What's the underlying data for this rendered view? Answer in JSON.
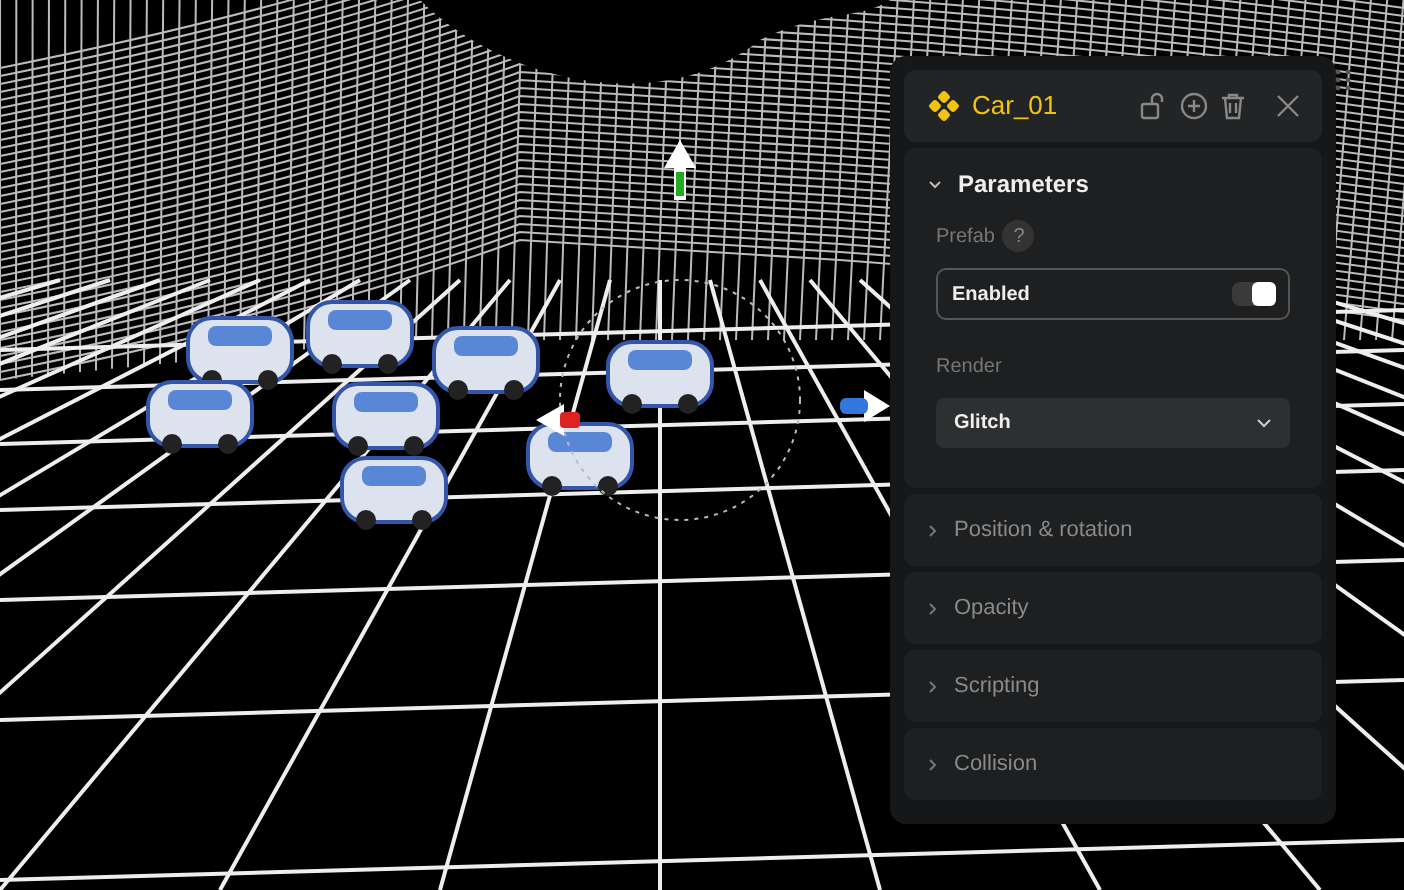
{
  "object": {
    "name": "Car_01"
  },
  "sections": [
    {
      "title": "Parameters",
      "expanded": true
    },
    {
      "title": "Position & rotation",
      "expanded": false
    },
    {
      "title": "Opacity",
      "expanded": false
    },
    {
      "title": "Scripting",
      "expanded": false
    },
    {
      "title": "Collision",
      "expanded": false
    }
  ],
  "parameters": {
    "prefab_label": "Prefab",
    "help": "?",
    "toggle": {
      "label": "Enabled",
      "on": true
    },
    "render_label": "Render",
    "render_value": "Glitch"
  }
}
